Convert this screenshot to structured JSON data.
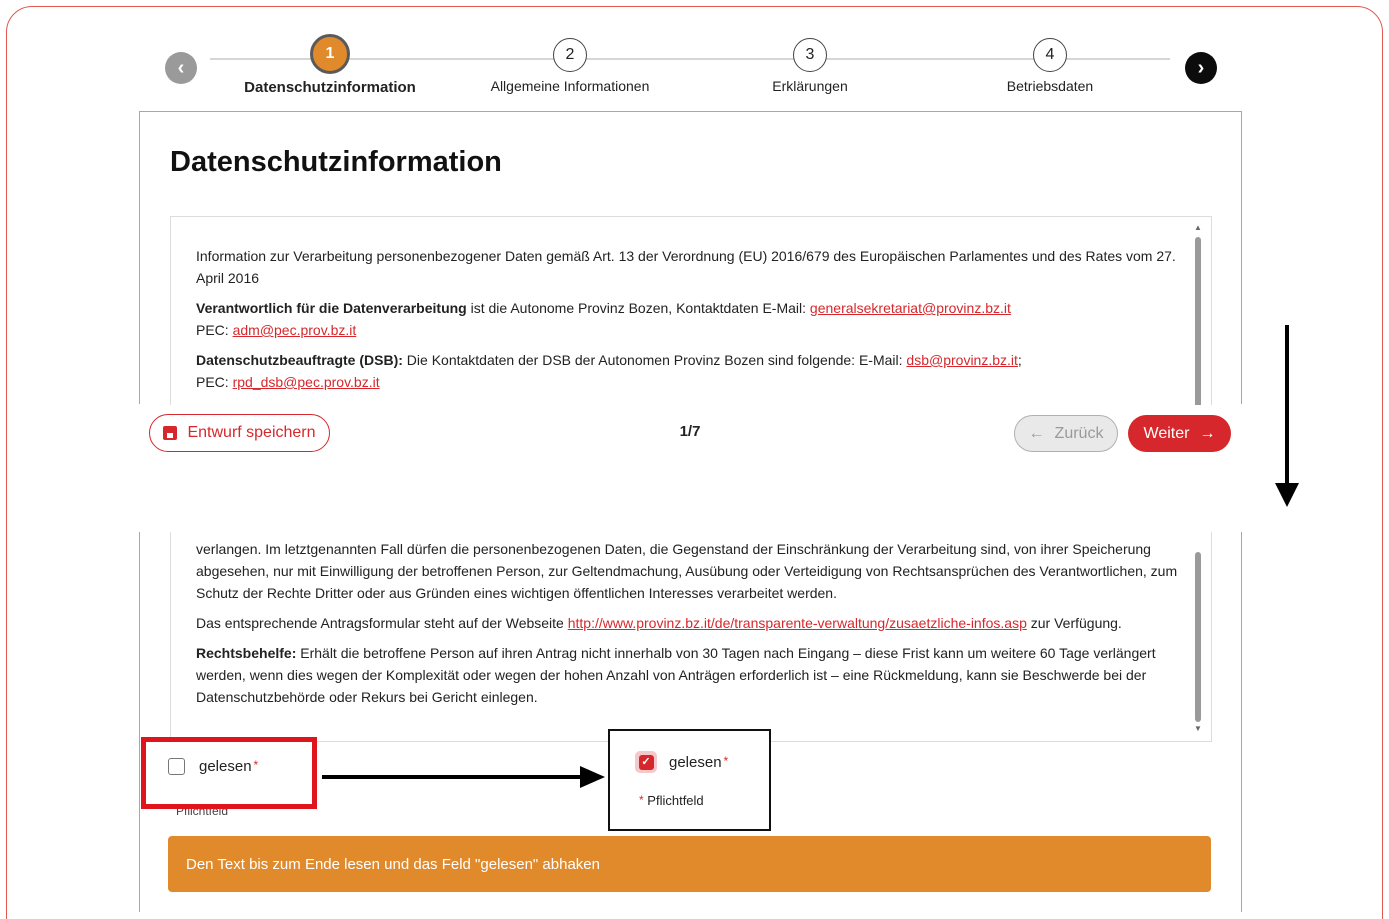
{
  "stepper": {
    "steps": [
      {
        "num": "1",
        "label": "Datenschutzinformation"
      },
      {
        "num": "2",
        "label": "Allgemeine Informationen"
      },
      {
        "num": "3",
        "label": "Erklärungen"
      },
      {
        "num": "4",
        "label": "Betriebsdaten"
      }
    ],
    "prev_icon": "‹",
    "next_icon": "›",
    "active_color": "#e08a2c"
  },
  "page": {
    "title": "Datenschutzinformation",
    "intro": "Information zur Verarbeitung personenbezogener Daten gemäß Art. 13 der Verordnung (EU) 2016/679 des Europäischen Parlamentes und des Rates vom 27. April 2016",
    "controller_bold": "Verantwortlich für die Datenverarbeitung",
    "controller_text": " ist die Autonome Provinz Bozen, Kontaktdaten E-Mail: ",
    "controller_email": "generalsekretariat@provinz.bz.it",
    "pec_label": "PEC: ",
    "controller_pec": "adm@pec.prov.bz.it",
    "dpo_bold": "Datenschutzbeauftragte (DSB):",
    "dpo_text": " Die Kontaktdaten der DSB der Autonomen Provinz Bozen sind folgende: E-Mail: ",
    "dpo_email": "dsb@provinz.bz.it",
    "dpo_sep": ";",
    "dpo_pec": "rpd_dsb@pec.prov.bz.it"
  },
  "actions": {
    "save_draft": "Entwurf speichern",
    "pager": "1/7",
    "back": "Zurück",
    "next": "Weiter",
    "accent": "#d6282c"
  },
  "bottom": {
    "para1": "verlangen. Im letztgenannten Fall dürfen die personenbezogenen Daten, die Gegenstand der Einschränkung der Verarbeitung sind, von ihrer Speicherung abgesehen, nur mit Einwilligung der betroffenen Person, zur Geltendmachung, Ausübung oder Verteidigung von Rechtsansprüchen des Verantwortlichen, zum Schutz der Rechte Dritter oder aus Gründen eines wichtigen öffentlichen Interesses verarbeitet werden.",
    "para2_pre": "Das entsprechende Antragsformular steht auf der Webseite ",
    "para2_link": "http://www.provinz.bz.it/de/transparente-verwaltung/zusaetzliche-infos.asp",
    "para2_post": " zur Verfügung.",
    "remedy_bold": "Rechtsbehelfe:",
    "remedy_text": " Erhält die betroffene Person auf ihren Antrag nicht innerhalb von 30 Tagen nach Eingang – diese Frist kann um weitere 60 Tage verlängert werden, wenn dies wegen der Komplexität oder wegen der hohen Anzahl von Anträgen erforderlich ist – eine Rückmeldung, kann sie Beschwerde bei der Datenschutzbehörde oder Rekurs bei Gericht einlegen.",
    "checkbox_label": "gelesen",
    "required_mark": "*",
    "required_note": "Pflichtfeld",
    "checked_label": "gelesen",
    "checked_note": "Pflichtfeld",
    "warning": "Den Text bis zum Ende lesen und das Feld \"gelesen\" abhaken",
    "warning_color": "#e08a2c"
  }
}
